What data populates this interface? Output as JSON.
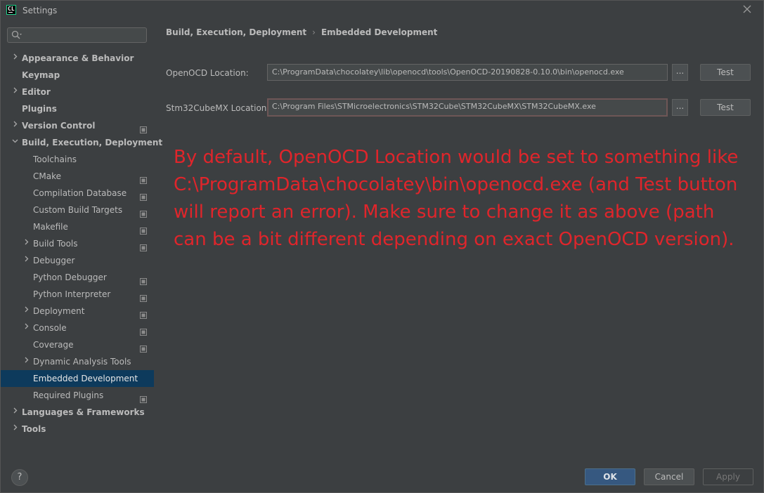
{
  "window": {
    "title": "Settings",
    "app_icon_text": "CL"
  },
  "search": {
    "placeholder": "",
    "value": ""
  },
  "tree": [
    {
      "label": "Appearance & Behavior",
      "level": 0,
      "bold": true,
      "expandable": true,
      "expanded": false,
      "project_icon": false,
      "selected": false
    },
    {
      "label": "Keymap",
      "level": 0,
      "bold": true,
      "expandable": false,
      "expanded": false,
      "project_icon": false,
      "selected": false
    },
    {
      "label": "Editor",
      "level": 0,
      "bold": true,
      "expandable": true,
      "expanded": false,
      "project_icon": false,
      "selected": false
    },
    {
      "label": "Plugins",
      "level": 0,
      "bold": true,
      "expandable": false,
      "expanded": false,
      "project_icon": false,
      "selected": false
    },
    {
      "label": "Version Control",
      "level": 0,
      "bold": true,
      "expandable": true,
      "expanded": false,
      "project_icon": true,
      "selected": false
    },
    {
      "label": "Build, Execution, Deployment",
      "level": 0,
      "bold": true,
      "expandable": true,
      "expanded": true,
      "project_icon": false,
      "selected": false
    },
    {
      "label": "Toolchains",
      "level": 1,
      "bold": false,
      "expandable": false,
      "expanded": false,
      "project_icon": false,
      "selected": false
    },
    {
      "label": "CMake",
      "level": 1,
      "bold": false,
      "expandable": false,
      "expanded": false,
      "project_icon": true,
      "selected": false
    },
    {
      "label": "Compilation Database",
      "level": 1,
      "bold": false,
      "expandable": false,
      "expanded": false,
      "project_icon": true,
      "selected": false
    },
    {
      "label": "Custom Build Targets",
      "level": 1,
      "bold": false,
      "expandable": false,
      "expanded": false,
      "project_icon": true,
      "selected": false
    },
    {
      "label": "Makefile",
      "level": 1,
      "bold": false,
      "expandable": false,
      "expanded": false,
      "project_icon": true,
      "selected": false
    },
    {
      "label": "Build Tools",
      "level": 1,
      "bold": false,
      "expandable": true,
      "expanded": false,
      "project_icon": true,
      "selected": false
    },
    {
      "label": "Debugger",
      "level": 1,
      "bold": false,
      "expandable": true,
      "expanded": false,
      "project_icon": false,
      "selected": false
    },
    {
      "label": "Python Debugger",
      "level": 1,
      "bold": false,
      "expandable": false,
      "expanded": false,
      "project_icon": true,
      "selected": false
    },
    {
      "label": "Python Interpreter",
      "level": 1,
      "bold": false,
      "expandable": false,
      "expanded": false,
      "project_icon": true,
      "selected": false
    },
    {
      "label": "Deployment",
      "level": 1,
      "bold": false,
      "expandable": true,
      "expanded": false,
      "project_icon": true,
      "selected": false
    },
    {
      "label": "Console",
      "level": 1,
      "bold": false,
      "expandable": true,
      "expanded": false,
      "project_icon": true,
      "selected": false
    },
    {
      "label": "Coverage",
      "level": 1,
      "bold": false,
      "expandable": false,
      "expanded": false,
      "project_icon": true,
      "selected": false
    },
    {
      "label": "Dynamic Analysis Tools",
      "level": 1,
      "bold": false,
      "expandable": true,
      "expanded": false,
      "project_icon": false,
      "selected": false
    },
    {
      "label": "Embedded Development",
      "level": 1,
      "bold": false,
      "expandable": false,
      "expanded": false,
      "project_icon": false,
      "selected": true
    },
    {
      "label": "Required Plugins",
      "level": 1,
      "bold": false,
      "expandable": false,
      "expanded": false,
      "project_icon": true,
      "selected": false
    },
    {
      "label": "Languages & Frameworks",
      "level": 0,
      "bold": true,
      "expandable": true,
      "expanded": false,
      "project_icon": false,
      "selected": false
    },
    {
      "label": "Tools",
      "level": 0,
      "bold": true,
      "expandable": true,
      "expanded": false,
      "project_icon": false,
      "selected": false
    }
  ],
  "breadcrumb": {
    "parent": "Build, Execution, Deployment",
    "separator": "›",
    "current": "Embedded Development"
  },
  "settings": {
    "openocd": {
      "label": "OpenOCD Location:",
      "value": "C:\\ProgramData\\chocolatey\\lib\\openocd\\tools\\OpenOCD-20190828-0.10.0\\bin\\openocd.exe",
      "browse_label": "...",
      "test_label": "Test"
    },
    "stm32cubemx": {
      "label": "Stm32CubeMX Location:",
      "value": "C:\\Program Files\\STMicroelectronics\\STM32Cube\\STM32CubeMX\\STM32CubeMX.exe",
      "browse_label": "...",
      "test_label": "Test"
    }
  },
  "annotation": {
    "text": "By default, OpenOCD Location would be set to something like C:\\ProgramData\\chocolatey\\bin\\openocd.exe (and Test button will report an error). Make sure to change it as above (path can be a bit different depending on exact OpenOCD version).",
    "color": "#e0252b"
  },
  "footer": {
    "help_label": "?",
    "ok_label": "OK",
    "cancel_label": "Cancel",
    "apply_label": "Apply"
  },
  "colors": {
    "background": "#3c3f41",
    "selection": "#0d3a5c",
    "ok_button": "#365880"
  }
}
